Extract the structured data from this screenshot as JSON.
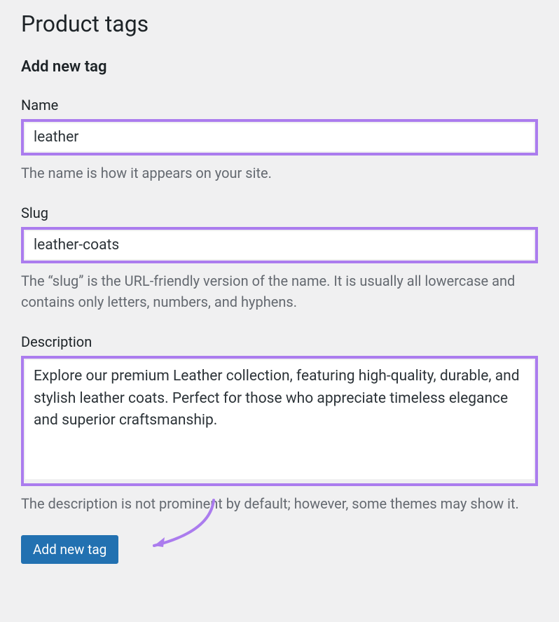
{
  "page": {
    "title": "Product tags"
  },
  "form": {
    "section_title": "Add new tag",
    "name": {
      "label": "Name",
      "value": "leather",
      "help": "The name is how it appears on your site."
    },
    "slug": {
      "label": "Slug",
      "value": "leather-coats",
      "help": "The “slug” is the URL-friendly version of the name. It is usually all lowercase and contains only letters, numbers, and hyphens."
    },
    "description": {
      "label": "Description",
      "value": "Explore our premium Leather collection, featuring high-quality, durable, and stylish leather coats. Perfect for those who appreciate timeless elegance and superior craftsmanship.",
      "help": "The description is not prominent by default; however, some themes may show it."
    },
    "submit_label": "Add new tag"
  },
  "colors": {
    "highlight": "#ab7cee",
    "primary_button": "#2271b1"
  }
}
